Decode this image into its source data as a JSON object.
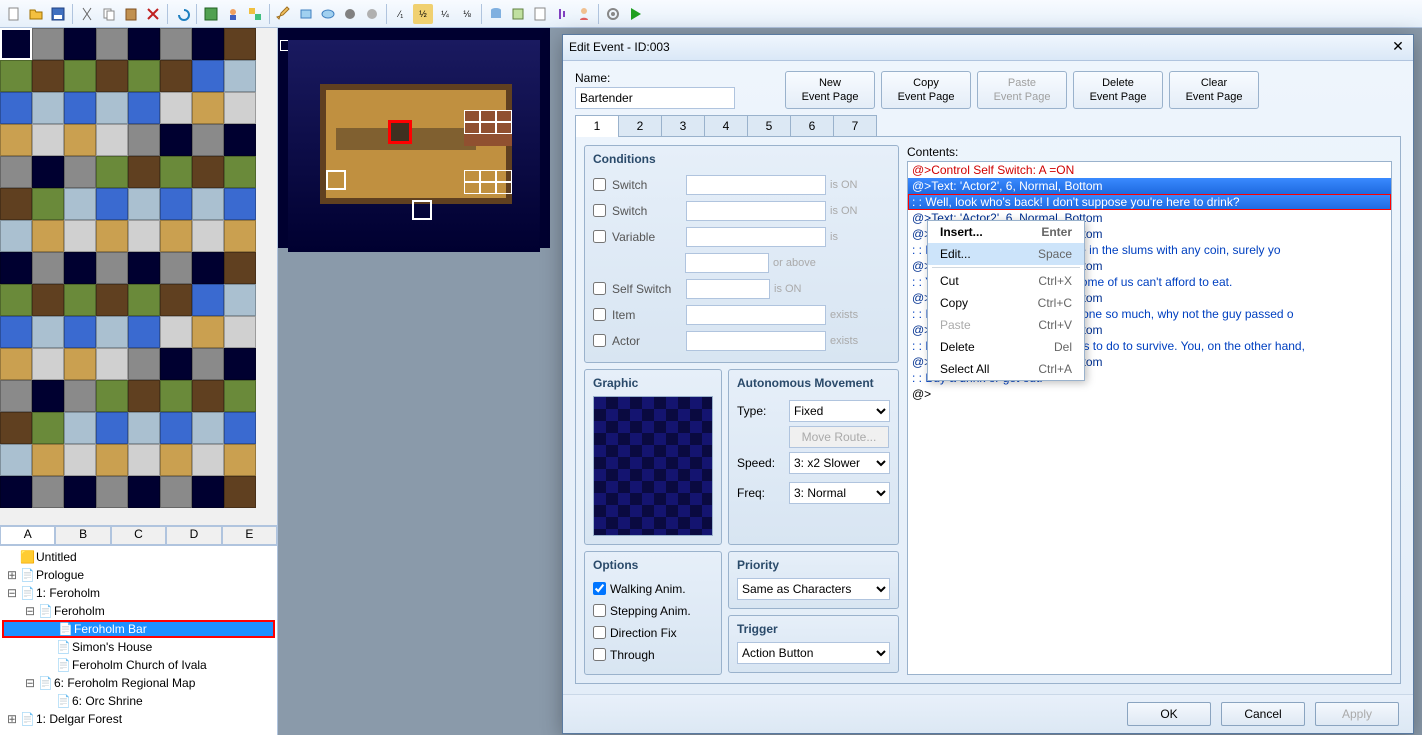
{
  "toolbar_icons": [
    "new-file",
    "open-file",
    "save-file",
    "cut",
    "copy",
    "paste",
    "delete",
    "undo",
    "image",
    "user",
    "layers",
    "pencil",
    "rect",
    "circle",
    "fill",
    "ellipse",
    "half",
    "half-y",
    "quarter",
    "eighth",
    "db",
    "db2",
    "db3",
    "music",
    "char",
    "settings",
    "play"
  ],
  "tile_tabs": [
    "A",
    "B",
    "C",
    "D",
    "E"
  ],
  "tile_tab_active": 0,
  "tree": [
    {
      "indent": 0,
      "exp": "",
      "icon": "🟨",
      "label": "Untitled"
    },
    {
      "indent": 0,
      "exp": "⊞",
      "icon": "📄",
      "label": "Prologue"
    },
    {
      "indent": 0,
      "exp": "⊟",
      "icon": "📄",
      "label": "1: Feroholm"
    },
    {
      "indent": 1,
      "exp": "⊟",
      "icon": "📄",
      "label": "Feroholm"
    },
    {
      "indent": 2,
      "exp": "",
      "icon": "📄",
      "label": "Feroholm Bar",
      "selected": true,
      "red": true
    },
    {
      "indent": 2,
      "exp": "",
      "icon": "📄",
      "label": "Simon's House"
    },
    {
      "indent": 2,
      "exp": "",
      "icon": "📄",
      "label": "Feroholm Church of Ivala"
    },
    {
      "indent": 1,
      "exp": "⊟",
      "icon": "📄",
      "label": "6: Feroholm Regional Map"
    },
    {
      "indent": 2,
      "exp": "",
      "icon": "📄",
      "label": "6: Orc Shrine"
    },
    {
      "indent": 0,
      "exp": "⊞",
      "icon": "📄",
      "label": "1: Delgar Forest"
    }
  ],
  "dialog": {
    "title": "Edit Event - ID:003",
    "name_label": "Name:",
    "name_value": "Bartender",
    "page_buttons": [
      {
        "l1": "New",
        "l2": "Event Page"
      },
      {
        "l1": "Copy",
        "l2": "Event Page"
      },
      {
        "l1": "Paste",
        "l2": "Event Page",
        "disabled": true
      },
      {
        "l1": "Delete",
        "l2": "Event Page"
      },
      {
        "l1": "Clear",
        "l2": "Event Page"
      }
    ],
    "tabs": [
      "1",
      "2",
      "3",
      "4",
      "5",
      "6",
      "7"
    ],
    "tab_active": 0,
    "conditions": {
      "title": "Conditions",
      "rows": [
        {
          "label": "Switch",
          "suffix": "is ON"
        },
        {
          "label": "Switch",
          "suffix": "is ON"
        },
        {
          "label": "Variable",
          "suffix": "is"
        },
        {
          "label": "",
          "suffix": "or above",
          "short": true
        },
        {
          "label": "Self Switch",
          "suffix": "is ON",
          "short": true
        },
        {
          "label": "Item",
          "suffix": "exists"
        },
        {
          "label": "Actor",
          "suffix": "exists"
        }
      ]
    },
    "graphic_title": "Graphic",
    "movement": {
      "title": "Autonomous Movement",
      "type_label": "Type:",
      "type_value": "Fixed",
      "route_btn": "Move Route...",
      "speed_label": "Speed:",
      "speed_value": "3: x2 Slower",
      "freq_label": "Freq:",
      "freq_value": "3: Normal"
    },
    "options": {
      "title": "Options",
      "items": [
        {
          "label": "Walking Anim.",
          "checked": true
        },
        {
          "label": "Stepping Anim.",
          "checked": false
        },
        {
          "label": "Direction Fix",
          "checked": false
        },
        {
          "label": "Through",
          "checked": false
        }
      ]
    },
    "priority": {
      "title": "Priority",
      "value": "Same as Characters"
    },
    "trigger": {
      "title": "Trigger",
      "value": "Action Button"
    },
    "contents_label": "Contents:",
    "contents": [
      {
        "cls": "cl-red",
        "text": "@>Control Self Switch: A =ON"
      },
      {
        "cls": "cl-dblue cl-sel",
        "text": "@>Text: 'Actor2', 6, Normal, Bottom"
      },
      {
        "cls": "cl-blue cl-sel cl-sel-border",
        "text": " :       : Well, look who's back! I don't suppose you're here to drink?"
      },
      {
        "cls": "cl-dblue",
        "text": "@>Text: 'Actor2', 6, Normal, Bottom"
      },
      {
        "cls": "cl-dblue",
        "text": "@>Text: 'Actor2', 6, Normal, Bottom"
      },
      {
        "cls": "cl-blue",
        "text": " :       : Don't play. You're the only one in the slums with any coin, surely yo"
      },
      {
        "cls": "cl-dblue",
        "text": "@>Text: 'Actor2', 6, Normal, Bottom"
      },
      {
        "cls": "cl-blue",
        "text": " :       : You sell the one thing when some of us can't afford to eat."
      },
      {
        "cls": "cl-dblue",
        "text": "@>Text: 'Actor2', 6, Normal, Bottom"
      },
      {
        "cls": "cl-blue",
        "text": " :       : If you wanted to lecture someone so much, why not the guy passed o"
      },
      {
        "cls": "cl-dblue",
        "text": "@>Text: 'Actor2', 6, Normal, Bottom"
      },
      {
        "cls": "cl-blue",
        "text": " :       : He does what he thinks he has to do to survive. You, on the other hand,"
      },
      {
        "cls": "cl-dblue",
        "text": "@>Text: 'Actor2', 6, Normal, Bottom"
      },
      {
        "cls": "cl-blue",
        "text": " :       : Buy a drink or get out!"
      },
      {
        "cls": "",
        "text": "@>"
      }
    ],
    "footer": {
      "ok": "OK",
      "cancel": "Cancel",
      "apply": "Apply"
    }
  },
  "context_menu": [
    {
      "label": "Insert...",
      "key": "Enter",
      "bold": true
    },
    {
      "label": "Edit...",
      "key": "Space",
      "hover": true
    },
    {
      "sep": true
    },
    {
      "label": "Cut",
      "key": "Ctrl+X"
    },
    {
      "label": "Copy",
      "key": "Ctrl+C"
    },
    {
      "label": "Paste",
      "key": "Ctrl+V",
      "disabled": true
    },
    {
      "label": "Delete",
      "key": "Del"
    },
    {
      "label": "Select All",
      "key": "Ctrl+A"
    }
  ]
}
